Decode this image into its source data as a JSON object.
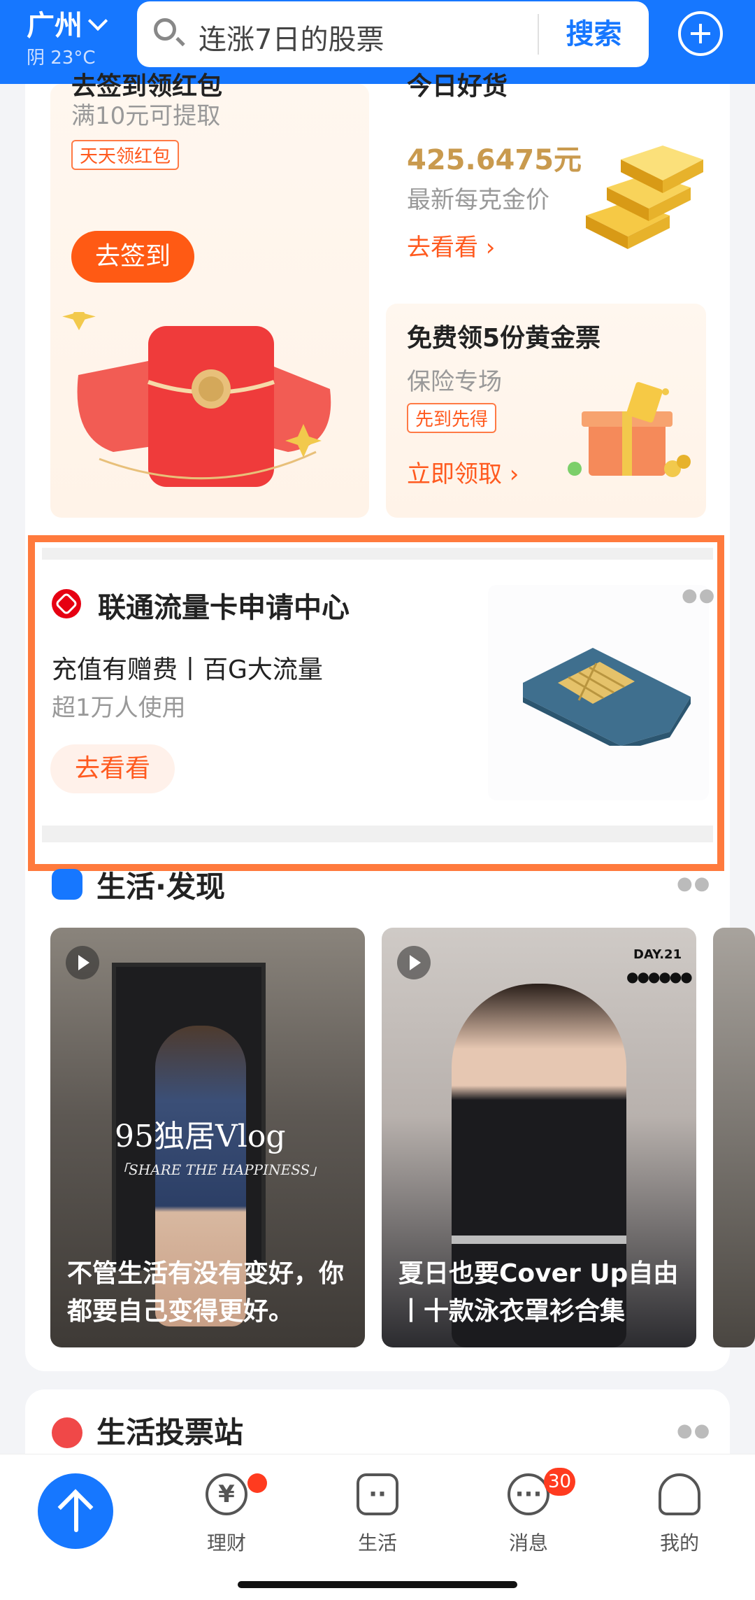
{
  "header": {
    "city": "广州",
    "weather": "阴 23°C",
    "search_placeholder": "连涨7日的股票",
    "search_button": "搜索"
  },
  "promos": {
    "signin": {
      "title": "去签到领红包",
      "subtitle": "满10元可提取",
      "tag": "天天领红包",
      "button": "去签到"
    },
    "gold": {
      "title": "今日好货",
      "price": "425.6475元",
      "subtitle": "最新每克金价",
      "link": "去看看"
    },
    "ticket": {
      "title": "免费领5份黄金票",
      "subtitle": "保险专场",
      "tag": "先到先得",
      "link": "立即领取"
    }
  },
  "ad": {
    "title": "联通流量卡申请中心",
    "subtitle": "充值有赠费丨百G大流量",
    "users": "超1万人使用",
    "button": "去看看"
  },
  "life": {
    "title": "生活·发现",
    "videos": [
      {
        "overlay_title": "95独居Vlog",
        "overlay_sub": "「SHARE THE HAPPINESS」",
        "caption": "不管生活有没有变好，你都要自己变得更好。"
      },
      {
        "overlay_title": "DAY.21",
        "caption": "夏日也要Cover Up自由丨十款泳衣罩衫合集"
      }
    ]
  },
  "vote": {
    "title": "生活投票站"
  },
  "tabs": [
    {
      "label": "理财",
      "badge": ""
    },
    {
      "label": "生活",
      "badge": ""
    },
    {
      "label": "消息",
      "badge": "30"
    },
    {
      "label": "我的",
      "badge": ""
    }
  ],
  "colors": {
    "brand_blue": "#1677ff",
    "accent_orange": "#ff5a1f",
    "gold_text": "#c99a4e",
    "highlight_border": "#ff7a3d"
  }
}
